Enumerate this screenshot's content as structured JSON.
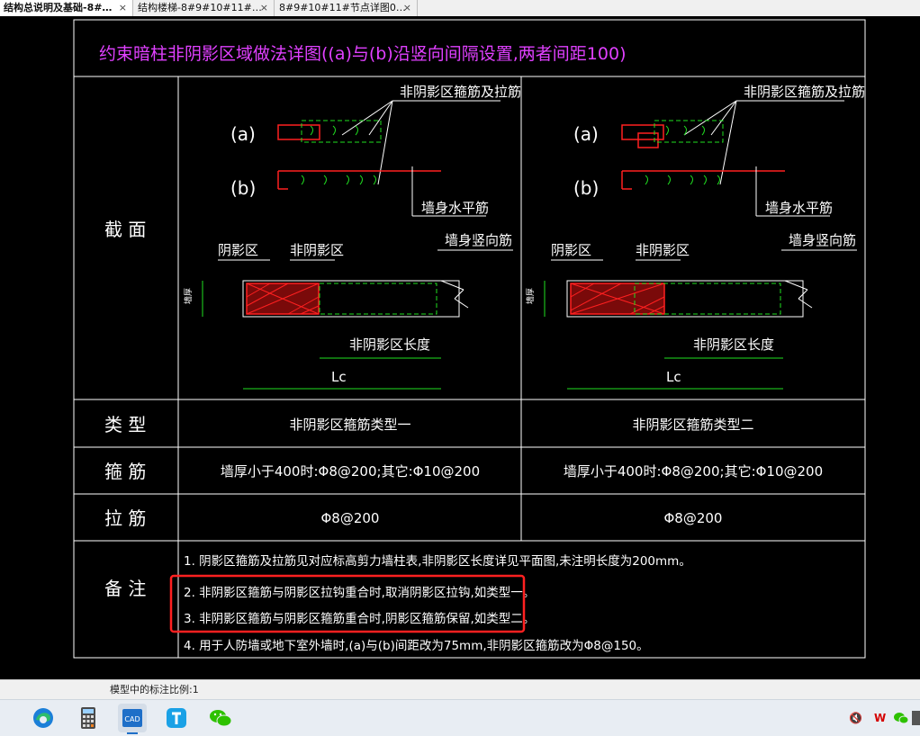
{
  "tabs": [
    {
      "label": "结构总说明及基础-8#…",
      "close": "×",
      "active": true
    },
    {
      "label": "结构楼梯-8#9#10#11#…",
      "close": "×",
      "active": false
    },
    {
      "label": "8#9#10#11#节点详图0…",
      "close": "×",
      "active": false
    }
  ],
  "drawing": {
    "title": "约束暗柱非阴影区域做法详图((a)与(b)沿竖向间隔设置,两者间距100)",
    "row_labels": {
      "section": "截  面",
      "type": "类  型",
      "stirrup": "箍  筋",
      "tie": "拉  筋",
      "notes": "备  注"
    },
    "section_labels": {
      "a": "(a)",
      "b": "(b)",
      "stirrup_tie": "非阴影区箍筋及拉筋",
      "wall_horizontal": "墙身水平筋",
      "wall_vertical": "墙身竖向筋",
      "shadow": "阴影区",
      "non_shadow": "非阴影区",
      "non_shadow_length": "非阴影区长度",
      "lc": "Lc",
      "wall_thickness": "墙厚"
    },
    "types": [
      "非阴影区箍筋类型一",
      "非阴影区箍筋类型二"
    ],
    "stirrups": [
      "墙厚小于400时:Φ8@200;其它:Φ10@200",
      "墙厚小于400时:Φ8@200;其它:Φ10@200"
    ],
    "ties": [
      "Φ8@200",
      "Φ8@200"
    ],
    "notes": [
      "1. 阴影区箍筋及拉筋见对应标高剪力墙柱表,非阴影区长度详见平面图,未注明长度为200mm。",
      "2. 非阴影区箍筋与阴影区拉钩重合时,取消阴影区拉钩,如类型一。",
      "3. 非阴影区箍筋与阴影区箍筋重合时,阴影区箍筋保留,如类型二。",
      "4. 用于人防墙或地下室外墙时,(a)与(b)间距改为75mm,非阴影区箍筋改为Φ8@150。"
    ]
  },
  "status": {
    "scale_text": "模型中的标注比例:1"
  },
  "taskbar": {
    "apps": [
      "edge-icon",
      "calculator-icon",
      "cad-viewer-icon",
      "text-app-icon",
      "wechat-icon"
    ],
    "active_app": "cad-viewer-icon",
    "cad_label": "CAD",
    "tray_mute": "🔇",
    "tray_wps": "W"
  },
  "colors": {
    "frame": "#ffffff",
    "title": "#e040ff",
    "text": "#ffffff",
    "rebar": "#ff2020",
    "hoop": "#20e020",
    "dimension": "#20e020",
    "concrete": "#ffffff",
    "highlight": "#ff2020"
  }
}
